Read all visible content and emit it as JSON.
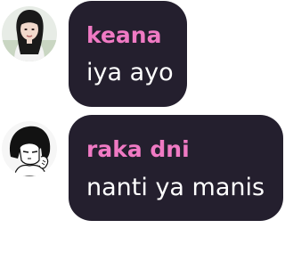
{
  "messages": [
    {
      "sender": "keana",
      "text": "iya ayo",
      "avatar": "woman-portrait-avatar"
    },
    {
      "sender": "raka dni",
      "text": "nanti ya manis",
      "avatar": "anime-character-avatar"
    }
  ],
  "colors": {
    "bubble": "#241f2e",
    "sender": "#f07ac4",
    "text": "#ffffff",
    "background": "#ffffff"
  }
}
